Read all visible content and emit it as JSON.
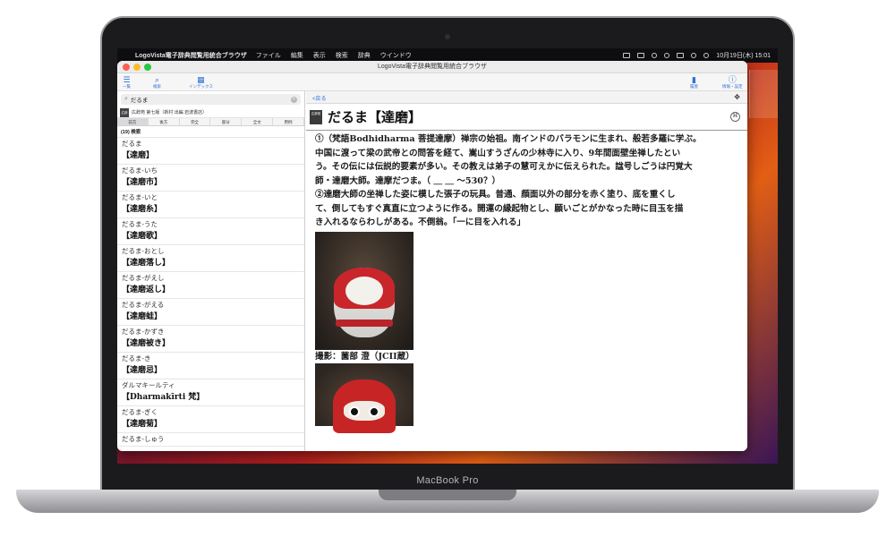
{
  "menubar": {
    "app_name": "LogoVista電子辞典閲覧用統合ブラウザ",
    "items": [
      "ファイル",
      "編集",
      "表示",
      "検索",
      "辞典",
      "ウインドウ"
    ],
    "datetime": "10月19日(木) 15:01"
  },
  "window": {
    "title": "LogoVista電子辞典閲覧用統合ブラウザ"
  },
  "toolbar": {
    "left": [
      {
        "label": "一覧"
      },
      {
        "label": "検索"
      },
      {
        "label": "インデックス"
      }
    ],
    "right": [
      {
        "label": "履歴"
      },
      {
        "label": "情報・設定"
      }
    ]
  },
  "left_pane": {
    "search_value": "だるま",
    "dictionary": "広辞苑 第七版（新村 出編 岩波書店）",
    "dictionary_badge": "広辞苑",
    "modes": [
      "前方",
      "後方",
      "完全",
      "部分",
      "全文",
      "用例"
    ],
    "active_mode": "前方",
    "result_count": "(19) 検索",
    "entries": [
      {
        "reading": "だるま",
        "headword": "【達磨】"
      },
      {
        "reading": "だるま‐いち",
        "headword": "【達磨市】"
      },
      {
        "reading": "だるま‐いと",
        "headword": "【達磨糸】"
      },
      {
        "reading": "だるま‐うた",
        "headword": "【達磨歌】"
      },
      {
        "reading": "だるま‐おとし",
        "headword": "【達磨落し】"
      },
      {
        "reading": "だるま‐がえし",
        "headword": "【達磨返し】"
      },
      {
        "reading": "だるま‐がえる",
        "headword": "【達磨蛙】"
      },
      {
        "reading": "だるま‐かずき",
        "headword": "【達磨被き】"
      },
      {
        "reading": "だるま‐き",
        "headword": "【達磨忌】"
      },
      {
        "reading": "ダルマキールティ",
        "headword": "【Dharmakīrti 梵】"
      },
      {
        "reading": "だるま‐ぎく",
        "headword": "【達磨菊】"
      },
      {
        "reading": "だるま‐しゅう",
        "headword": ""
      }
    ]
  },
  "right_pane": {
    "back_label": "<戻る",
    "dict_icon": "広辞苑",
    "title": "だるま【達磨】",
    "body_lines": [
      "①（梵語Bodhidharma 菩提達摩）禅宗の始祖。南インドのバラモンに生まれ、般若多羅に学ぶ。",
      "中国に渡って梁の武帝との問答を経て、嵩山すうざんの少林寺に入り、9年間面壁坐禅したとい",
      "う。その伝には伝説的要素が多い。その教えは弟子の慧可えかに伝えられた。諡号しごうは円覚大",
      "師・達磨大師。達摩だつま。（ ＿ ＿ 〜530？）",
      "②達磨大師の坐禅した姿に模した張子の玩具。普通、顔面以外の部分を赤く塗り、底を重くし",
      "て、倒してもすぐ真直に立つように作る。開運の縁起物とし、願いごとがかなった時に目玉を描",
      "き入れるならわしがある。不倒翁。「一に目を入れる」"
    ],
    "caption": "撮影：薗部 澄（JCII蔵）"
  },
  "laptop": {
    "model": "MacBook Pro"
  }
}
